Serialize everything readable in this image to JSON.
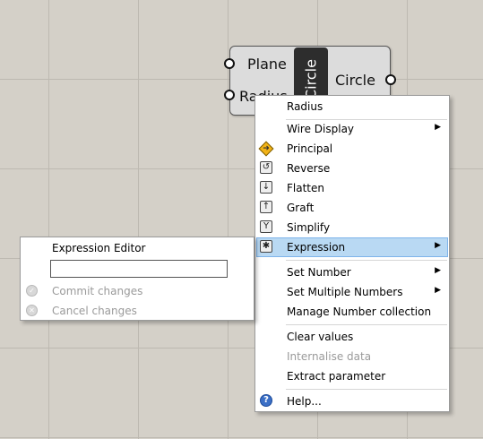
{
  "component": {
    "name": "Circle",
    "inputs": [
      "Plane",
      "Radius"
    ],
    "output": "Circle"
  },
  "menu": {
    "header": "Radius",
    "items": [
      {
        "label": "Wire Display",
        "submenu": true
      },
      {
        "label": "Principal",
        "icon": "principal-icon"
      },
      {
        "label": "Reverse",
        "icon": "reverse-icon"
      },
      {
        "label": "Flatten",
        "icon": "flatten-icon"
      },
      {
        "label": "Graft",
        "icon": "graft-icon"
      },
      {
        "label": "Simplify",
        "icon": "simplify-icon"
      },
      {
        "label": "Expression",
        "icon": "expression-icon",
        "submenu": true,
        "highlighted": true
      },
      {
        "label": "Set Number",
        "submenu": true
      },
      {
        "label": "Set Multiple Numbers",
        "submenu": true
      },
      {
        "label": "Manage Number collection"
      },
      {
        "label": "Clear values"
      },
      {
        "label": "Internalise data",
        "disabled": true
      },
      {
        "label": "Extract parameter"
      },
      {
        "label": "Help...",
        "icon": "help-icon"
      }
    ]
  },
  "expression_menu": {
    "title": "Expression Editor",
    "input_value": "",
    "commit_label": "Commit changes",
    "cancel_label": "Cancel changes"
  },
  "colors": {
    "canvas": "#d4d0c8",
    "highlight": "#b9d9f3",
    "component_body": "#2d2d2d"
  }
}
